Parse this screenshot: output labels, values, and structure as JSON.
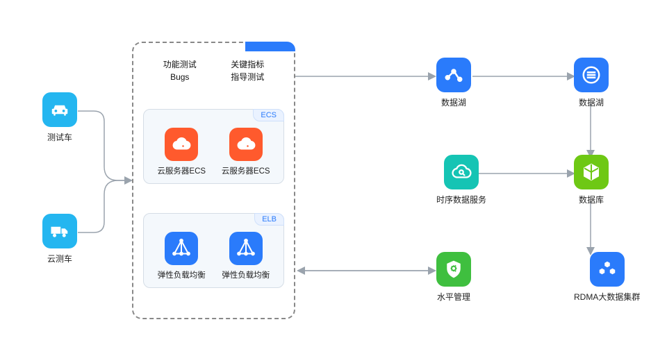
{
  "left": {
    "car": {
      "label": "测试车"
    },
    "truck": {
      "label": "云测车"
    }
  },
  "center": {
    "header": {
      "col1_line1": "功能测试",
      "col1_line2": "Bugs",
      "col2_line1": "关键指标",
      "col2_line2": "指导测试"
    },
    "ecs": {
      "tag": "ECS",
      "item_label": "云服务器ECS"
    },
    "elb": {
      "tag": "ELB",
      "item_label": "弹性负载均衡"
    }
  },
  "right": {
    "analytics": {
      "label": "数据湖"
    },
    "stream": {
      "label": "数据湖"
    },
    "search": {
      "label": "时序数据服务"
    },
    "cube": {
      "label": "数据库"
    },
    "shield": {
      "label": "水平管理"
    },
    "modules": {
      "label": "RDMA大数据集群"
    }
  }
}
